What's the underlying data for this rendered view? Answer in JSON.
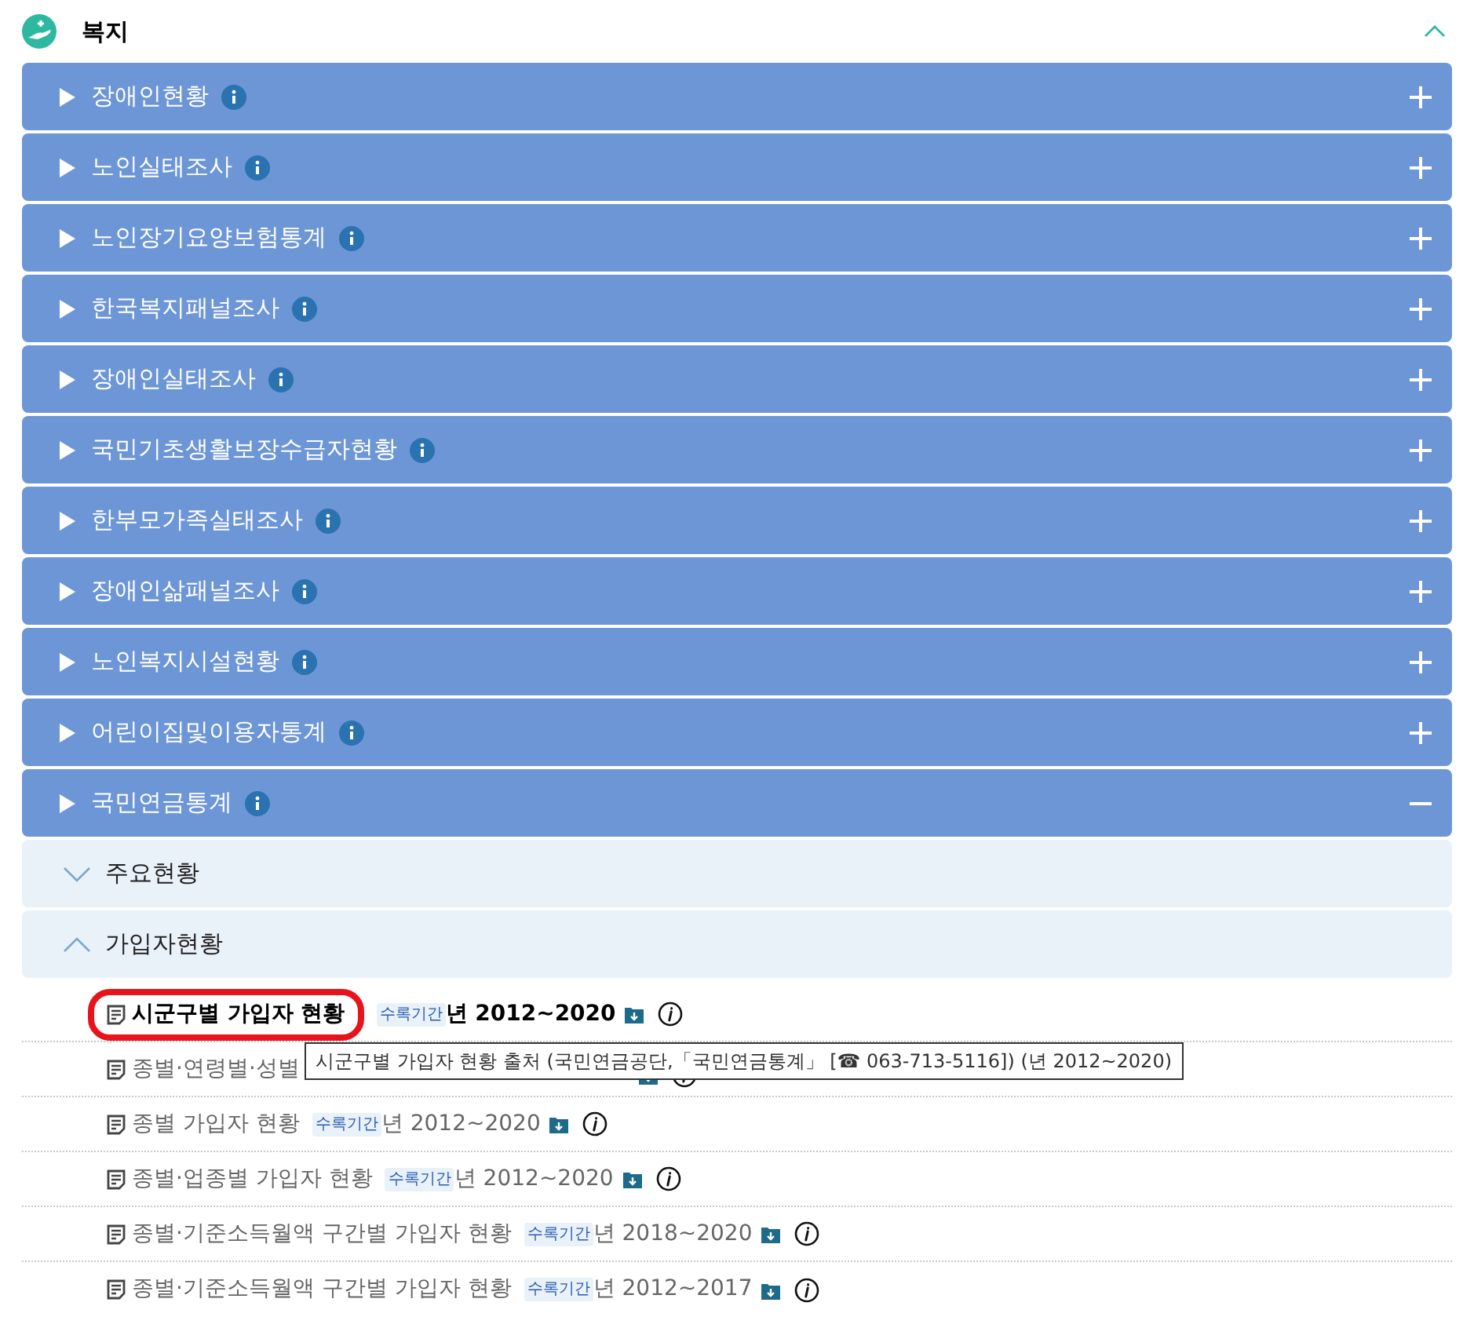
{
  "section": {
    "title": "복지",
    "expanded": true
  },
  "categories": [
    {
      "label": "장애인현황",
      "expanded": false
    },
    {
      "label": "노인실태조사",
      "expanded": false
    },
    {
      "label": "노인장기요양보험통계",
      "expanded": false
    },
    {
      "label": "한국복지패널조사",
      "expanded": false
    },
    {
      "label": "장애인실태조사",
      "expanded": false
    },
    {
      "label": "국민기초생활보장수급자현황",
      "expanded": false
    },
    {
      "label": "한부모가족실태조사",
      "expanded": false
    },
    {
      "label": "장애인삶패널조사",
      "expanded": false
    },
    {
      "label": "노인복지시설현황",
      "expanded": false
    },
    {
      "label": "어린이집및이용자통계",
      "expanded": false
    },
    {
      "label": "국민연금통계",
      "expanded": true,
      "groups": [
        {
          "label": "주요현황",
          "expanded": false
        },
        {
          "label": "가입자현황",
          "expanded": true,
          "items": [
            {
              "title": "시군구별 가입자 현황",
              "badge": "수록기간",
              "period": "년 2012~2020",
              "selected": true
            },
            {
              "title": "종별·연령별·성별",
              "selected": false
            },
            {
              "title": "종별 가입자 현황",
              "badge": "수록기간",
              "period": "년 2012~2020",
              "selected": false
            },
            {
              "title": "종별·업종별 가입자 현황",
              "badge": "수록기간",
              "period": "년 2012~2020",
              "selected": false
            },
            {
              "title": "종별·기준소득월액 구간별 가입자 현황",
              "badge": "수록기간",
              "period": "년 2018~2020",
              "selected": false
            },
            {
              "title": "종별·기준소득월액 구간별 가입자 현황",
              "badge": "수록기간",
              "period": "년 2012~2017",
              "selected": false
            }
          ]
        }
      ]
    }
  ],
  "tooltip": "시군구별 가입자 현황 출처 (국민연금공단,「국민연금통계」 [☎ 063-713-5116]) (년 2012~2020)"
}
